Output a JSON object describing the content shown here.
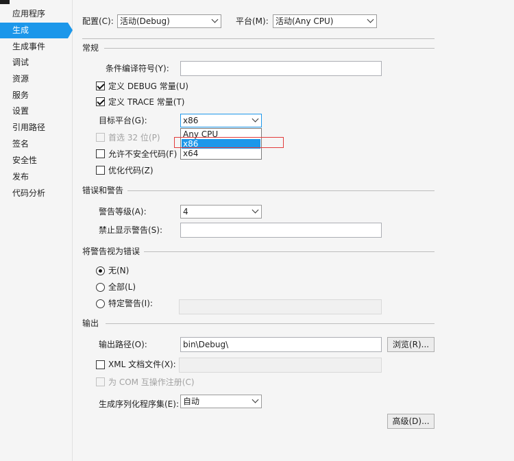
{
  "sidebar": {
    "items": [
      {
        "label": "应用程序"
      },
      {
        "label": "生成"
      },
      {
        "label": "生成事件"
      },
      {
        "label": "调试"
      },
      {
        "label": "资源"
      },
      {
        "label": "服务"
      },
      {
        "label": "设置"
      },
      {
        "label": "引用路径"
      },
      {
        "label": "签名"
      },
      {
        "label": "安全性"
      },
      {
        "label": "发布"
      },
      {
        "label": "代码分析"
      }
    ],
    "active_index": 1
  },
  "header": {
    "config_label": "配置(C):",
    "config_value": "活动(Debug)",
    "platform_label": "平台(M):",
    "platform_value": "活动(Any CPU)"
  },
  "general": {
    "section_title": "常规",
    "conditional_symbols_label": "条件编译符号(Y):",
    "conditional_symbols_value": "",
    "define_debug_label": "定义 DEBUG 常量(U)",
    "define_debug_checked": true,
    "define_trace_label": "定义 TRACE 常量(T)",
    "define_trace_checked": true,
    "target_platform_label": "目标平台(G):",
    "target_platform_value": "x86",
    "target_platform_options": [
      "Any CPU",
      "x86",
      "x64"
    ],
    "prefer32_label": "首选 32 位(P)",
    "allow_unsafe_label": "允许不安全代码(F)",
    "optimize_label": "优化代码(Z)"
  },
  "errors_warnings": {
    "section_title": "错误和警告",
    "warning_level_label": "警告等级(A):",
    "warning_level_value": "4",
    "suppress_label": "禁止显示警告(S):",
    "suppress_value": ""
  },
  "treat_warnings": {
    "section_title": "将警告视为错误",
    "none_label": "无(N)",
    "all_label": "全部(L)",
    "specific_label": "特定警告(I):",
    "selected": "none"
  },
  "output": {
    "section_title": "输出",
    "output_path_label": "输出路径(O):",
    "output_path_value": "bin\\Debug\\",
    "browse_label": "浏览(R)...",
    "xml_doc_label": "XML 文档文件(X):",
    "com_interop_label": "为 COM 互操作注册(C)",
    "serialization_label": "生成序列化程序集(E):",
    "serialization_value": "自动",
    "advanced_label": "高级(D)..."
  },
  "colors": {
    "accent": "#1c97ea",
    "highlight_box": "#e23b3b"
  }
}
